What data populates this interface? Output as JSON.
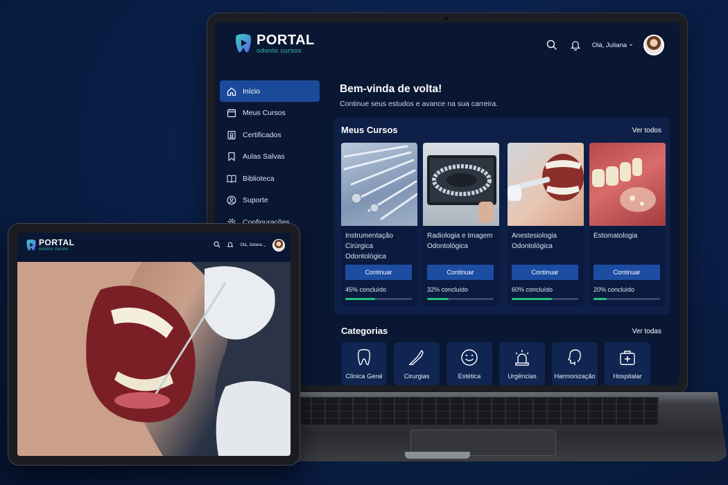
{
  "brand": {
    "title": "PORTAL",
    "subtitle": "odonto cursos"
  },
  "header": {
    "greeting": "Olá, Juliana",
    "greeting_caret": "⌄"
  },
  "sidebar": {
    "items": [
      {
        "label": "Início",
        "icon": "home-icon",
        "active": true
      },
      {
        "label": "Meus Cursos",
        "icon": "calendar-icon"
      },
      {
        "label": "Certificados",
        "icon": "certificate-icon"
      },
      {
        "label": "Aulas Salvas",
        "icon": "bookmark-icon"
      },
      {
        "label": "Biblioteca",
        "icon": "book-icon"
      },
      {
        "label": "Suporte",
        "icon": "support-icon"
      },
      {
        "label": "Configurações",
        "icon": "gear-icon"
      }
    ]
  },
  "welcome": {
    "title": "Bem-vinda de volta!",
    "subtitle": "Continue seus estudos e avance na sua carreira."
  },
  "my_courses": {
    "title": "Meus Cursos",
    "see_all": "Ver todos",
    "items": [
      {
        "title": "Instrumentação Cirúrgica Odontológica",
        "button": "Continuar",
        "progress_label": "45% concluído",
        "progress": 0.45
      },
      {
        "title": "Radiologia e Imagem Odontológica",
        "button": "Continuar",
        "progress_label": "32% concluído",
        "progress": 0.32
      },
      {
        "title": "Anestesiologia Odontológica",
        "button": "Continuar",
        "progress_label": "60% concluído",
        "progress": 0.6
      },
      {
        "title": "Estomatologia",
        "button": "Continuar",
        "progress_label": "20% concluído",
        "progress": 0.2
      }
    ]
  },
  "categories": {
    "title": "Categorias",
    "see_all": "Ver todas",
    "items": [
      {
        "label": "Clínica Geral",
        "icon": "tooth-icon"
      },
      {
        "label": "Cirurgias",
        "icon": "scalpel-icon"
      },
      {
        "label": "Estética",
        "icon": "smile-icon"
      },
      {
        "label": "Urgências",
        "icon": "siren-icon"
      },
      {
        "label": "Harmonização",
        "icon": "face-profile-icon"
      },
      {
        "label": "Hospitalar",
        "icon": "medical-kit-icon"
      }
    ]
  },
  "colors": {
    "accent": "#1d4da3",
    "progress": "#25c07f",
    "brand_green": "#38c6a4"
  }
}
